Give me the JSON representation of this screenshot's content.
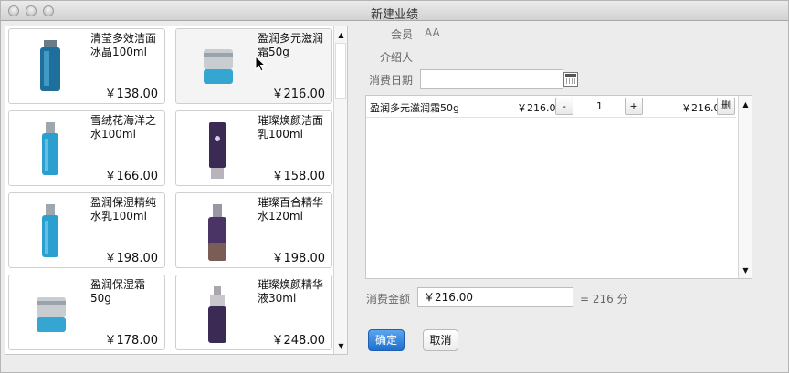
{
  "window": {
    "title": "新建业绩"
  },
  "products": [
    {
      "name": "清莹多效洁面冰晶100ml",
      "price": "￥138.00",
      "icon": "tube-bottle-blue-icon"
    },
    {
      "name": "盈润多元滋润霜50g",
      "price": "￥216.00",
      "icon": "cream-jar-blue-icon"
    },
    {
      "name": "雪绒花海洋之水100ml",
      "price": "￥166.00",
      "icon": "tall-bottle-blue-icon"
    },
    {
      "name": "璀璨焕颜洁面乳100ml",
      "price": "￥158.00",
      "icon": "tube-bottle-purple-icon"
    },
    {
      "name": "盈润保湿精纯水乳100ml",
      "price": "￥198.00",
      "icon": "tall-bottle-blue-icon"
    },
    {
      "name": "璀璨百合精华水120ml",
      "price": "￥198.00",
      "icon": "tall-bottle-purple-icon"
    },
    {
      "name": "盈润保湿霜50g",
      "price": "￥178.00",
      "icon": "cream-jar-blue-icon"
    },
    {
      "name": "璀璨焕颜精华液30ml",
      "price": "￥248.00",
      "icon": "pump-bottle-purple-icon"
    }
  ],
  "form": {
    "member_label": "会员",
    "member_value": "AA",
    "referrer_label": "介绍人",
    "date_label": "消费日期",
    "date_value": "",
    "amount_label": "消费金额",
    "amount_value": "￥216.00",
    "points_text": "= 216 分"
  },
  "order_items": [
    {
      "name": "盈润多元滋润霜50g",
      "unit_price": "￥216.00",
      "minus": "-",
      "qty": "1",
      "plus": "+",
      "subtotal": "￥216.00",
      "delete": "删"
    }
  ],
  "buttons": {
    "confirm": "确定",
    "cancel": "取消"
  },
  "colors": {
    "primary": "#1f6fce",
    "product_blue": "#2a9fd0",
    "product_purple": "#4a3466"
  }
}
